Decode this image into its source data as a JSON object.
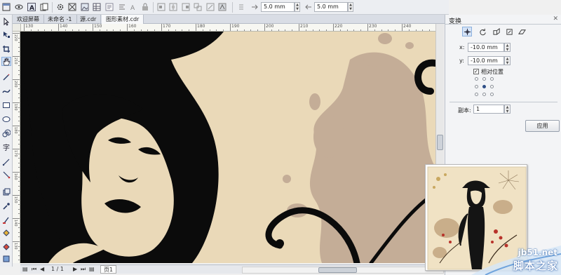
{
  "propbar": {
    "nudge_value": "5.0 mm",
    "duplicate_distance": "5.0 mm"
  },
  "tabs": [
    {
      "label": "欢迎屏幕",
      "active": false
    },
    {
      "label": "未命名 -1",
      "active": false
    },
    {
      "label": "源.cdr",
      "active": false
    },
    {
      "label": "图形素材.cdr",
      "active": true
    }
  ],
  "ruler": {
    "h_labels": [
      "130",
      "140",
      "150",
      "160",
      "170",
      "180",
      "190",
      "200",
      "210",
      "220",
      "230",
      "240"
    ],
    "v_labels": [
      "220",
      "210",
      "200",
      "190",
      "180",
      "170",
      "160",
      "150",
      "140",
      "130"
    ]
  },
  "docker": {
    "title": "变换",
    "x_label": "x:",
    "x_value": "-10.0 mm",
    "y_label": "y:",
    "y_value": "-10.0 mm",
    "relative_label": "相对位置",
    "relative_checked": true,
    "copies_label": "副本:",
    "copies_value": "1",
    "apply_label": "应用"
  },
  "statusbar": {
    "page_indicator": "1 / 1",
    "page_tab": "页1"
  },
  "watermark": {
    "site": "jb51.net",
    "name": "脚本之家"
  },
  "colors": {
    "background_beige": "#ead9b8",
    "splash_tan": "#c4ad97",
    "ink_black": "#0b0b0b",
    "accent_blue": "#2f4f86"
  }
}
